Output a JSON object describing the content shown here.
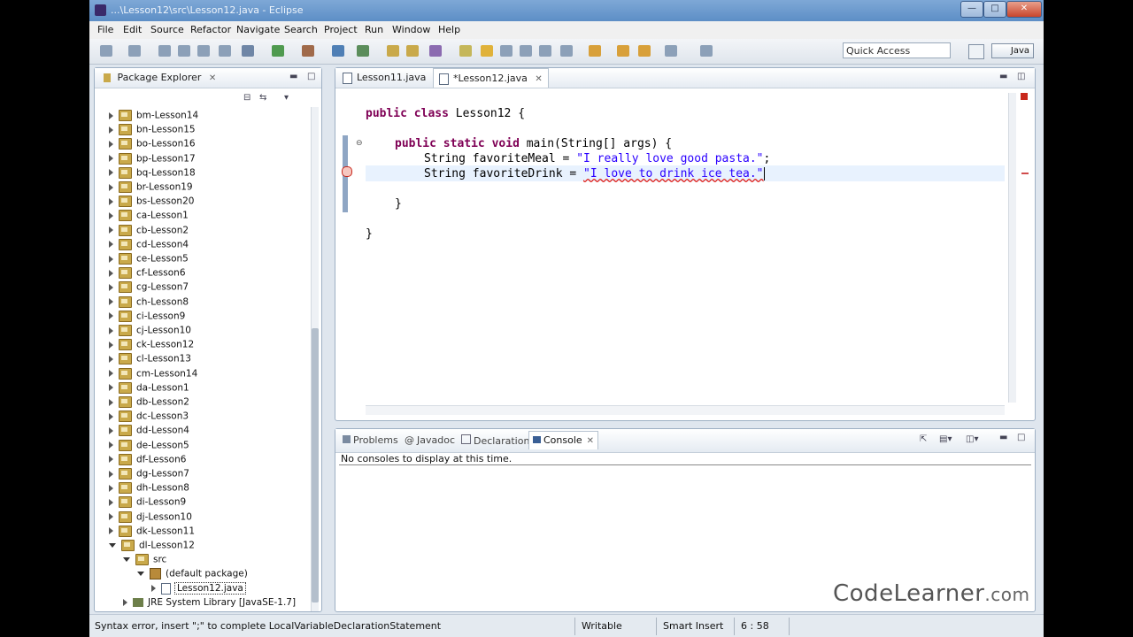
{
  "window": {
    "title": "...\\Lesson12\\src\\Lesson12.java - Eclipse",
    "minimize": "—",
    "maximize": "□",
    "close": "✕"
  },
  "menu": [
    "File",
    "Edit",
    "Source",
    "Refactor",
    "Navigate",
    "Search",
    "Project",
    "Run",
    "Window",
    "Help"
  ],
  "toolbar": {
    "quick_access": "Quick Access",
    "perspective": "Java"
  },
  "package_explorer": {
    "tab_label": "Package Explorer",
    "close": "✕",
    "projects": [
      "bm-Lesson14",
      "bn-Lesson15",
      "bo-Lesson16",
      "bp-Lesson17",
      "bq-Lesson18",
      "br-Lesson19",
      "bs-Lesson20",
      "ca-Lesson1",
      "cb-Lesson2",
      "cd-Lesson4",
      "ce-Lesson5",
      "cf-Lesson6",
      "cg-Lesson7",
      "ch-Lesson8",
      "ci-Lesson9",
      "cj-Lesson10",
      "ck-Lesson12",
      "cl-Lesson13",
      "cm-Lesson14",
      "da-Lesson1",
      "db-Lesson2",
      "dc-Lesson3",
      "dd-Lesson4",
      "de-Lesson5",
      "df-Lesson6",
      "dg-Lesson7",
      "dh-Lesson8",
      "di-Lesson9",
      "dj-Lesson10",
      "dk-Lesson11",
      "dl-Lesson12"
    ],
    "src": "src",
    "default_package": "(default package)",
    "selected_file": "Lesson12.java",
    "jre": "JRE System Library [JavaSE-1.7]"
  },
  "editor": {
    "tabs": [
      {
        "label": "Lesson11.java",
        "active": false
      },
      {
        "label": "*Lesson12.java",
        "active": true
      }
    ],
    "code": {
      "line1_kw1": "public",
      "line1_kw2": "class",
      "line1_rest": " Lesson12 {",
      "line2_kw1": "public",
      "line2_kw2": "static",
      "line2_kw3": "void",
      "line2_rest": " main(String[] args) {",
      "line3_pre": "String favoriteMeal = ",
      "line3_str": "\"I really love good pasta.\"",
      "line3_post": ";",
      "line4_pre": "String favoriteDrink = ",
      "line4_str": "\"I love to drink ice tea.\"",
      "line5": "}",
      "line6": "}"
    }
  },
  "bottom_panel": {
    "tabs": [
      {
        "label": "Problems",
        "active": false
      },
      {
        "label": "Javadoc",
        "active": false
      },
      {
        "label": "Declaration",
        "active": false
      },
      {
        "label": "Console",
        "active": true
      }
    ],
    "message": "No consoles to display at this time."
  },
  "status": {
    "message": "Syntax error, insert \";\" to complete LocalVariableDeclarationStatement",
    "writable": "Writable",
    "insert_mode": "Smart Insert",
    "position": "6 : 58"
  },
  "watermark": {
    "main": "CodeLearner",
    "suffix": ".com"
  }
}
